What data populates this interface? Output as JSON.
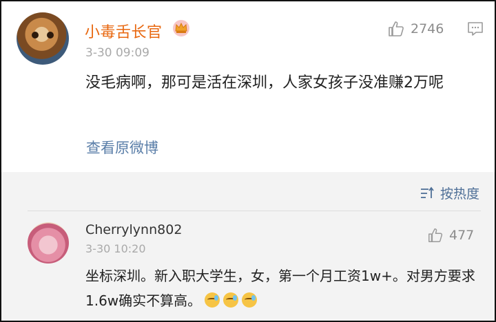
{
  "comment": {
    "username": "小毒舌长官",
    "timestamp": "3-30 09:09",
    "like_count": "2746",
    "text": "没毛病啊，那可是活在深圳，人家女孩子没准赚2万呢",
    "view_original_label": "查看原微博",
    "username_color": "#e8670f",
    "link_color": "#5a7ea8",
    "badge_icon": "crown-icon"
  },
  "sort": {
    "label": "按热度",
    "icon": "sort-icon"
  },
  "reply": {
    "username": "Cherrylynn802",
    "timestamp": "3-30 10:20",
    "like_count": "477",
    "text": "坐标深圳。新入职大学生，女，第一个月工资1w+。对男方要求1.6w确实不算高。",
    "emoji_icons": [
      "sweat-smile-emoji",
      "sweat-smile-emoji",
      "sweat-smile-emoji"
    ]
  }
}
